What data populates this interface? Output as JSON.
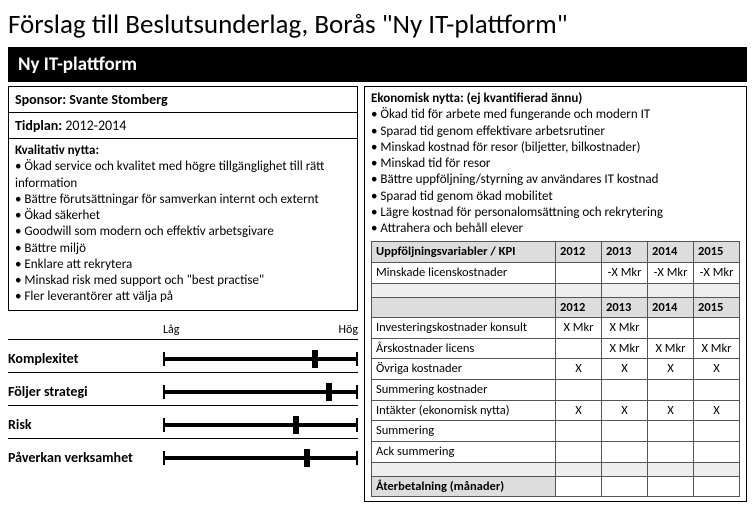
{
  "page_title": "Förslag till Beslutsunderlag, Borås \"Ny IT-plattform\"",
  "header_bar": "Ny IT-plattform",
  "left": {
    "sponsor_label": "Sponsor:",
    "sponsor_value": "Svante Stomberg",
    "tidplan_label": "Tidplan:",
    "tidplan_value": "2012-2014",
    "kval_heading": "Kvalitativ nytta:",
    "kval_items": [
      "Ökad service och kvalitet med högre tillgänglighet till rätt information",
      "Bättre förutsättningar för samverkan internt och externt",
      "Ökad säkerhet",
      "Goodwill som modern och effektiv arbetsgivare",
      "Bättre miljö",
      "Enklare att rekrytera",
      "Minskad risk med support och \"best practise\"",
      "Fler leverantörer att välja på"
    ],
    "slider_low": "Låg",
    "slider_high": "Hög",
    "sliders": [
      {
        "label": "Komplexitet",
        "pos": 78
      },
      {
        "label": "Följer strategi",
        "pos": 85
      },
      {
        "label": "Risk",
        "pos": 68
      },
      {
        "label": "Påverkan verksamhet",
        "pos": 74
      }
    ]
  },
  "right": {
    "ekon_heading": "Ekonomisk nytta: (ej kvantifierad ännu)",
    "ekon_items": [
      "Ökad tid för arbete med fungerande och modern IT",
      "Sparad tid genom effektivare arbetsrutiner",
      "Minskad kostnad för resor (biljetter, bilkostnader)",
      "Minskad tid för resor",
      "Bättre uppföljning/styrning av användares IT kostnad",
      "Sparad tid genom ökad mobilitet",
      "Lägre kostnad för personalomsättning och rekrytering",
      "Attrahera och behåll elever"
    ],
    "kpi_header": "Uppföljningsvariabler / KPI",
    "years": [
      "2012",
      "2013",
      "2014",
      "2015"
    ],
    "kpi_rows": [
      {
        "label": "Minskade licenskostnader",
        "cells": [
          "",
          "-X Mkr",
          "-X Mkr",
          "-X Mkr"
        ]
      }
    ],
    "cost_rows": [
      {
        "label": "Investeringskostnader konsult",
        "cells": [
          "X Mkr",
          "X Mkr",
          "",
          ""
        ]
      },
      {
        "label": "Årskostnader licens",
        "cells": [
          "",
          "X Mkr",
          "X Mkr",
          "X Mkr"
        ]
      },
      {
        "label": "Övriga kostnader",
        "cells": [
          "X",
          "X",
          "X",
          "X"
        ]
      },
      {
        "label": "Summering kostnader",
        "cells": [
          "",
          "",
          "",
          ""
        ]
      },
      {
        "label": "Intäkter (ekonomisk nytta)",
        "cells": [
          "X",
          "X",
          "X",
          "X"
        ]
      },
      {
        "label": "Summering",
        "cells": [
          "",
          "",
          "",
          ""
        ]
      },
      {
        "label": "Ack summering",
        "cells": [
          "",
          "",
          "",
          ""
        ]
      }
    ],
    "payback_label": "Återbetalning (månader)",
    "payback_cells": [
      "",
      "",
      "",
      ""
    ]
  }
}
